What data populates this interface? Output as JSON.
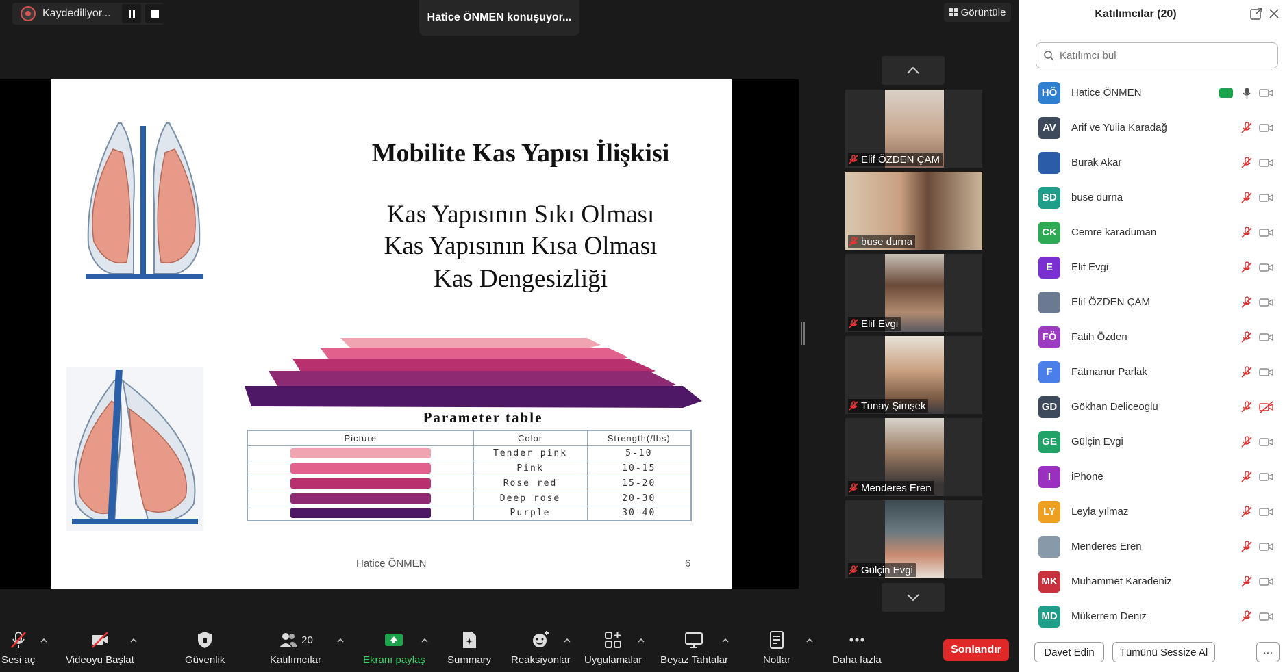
{
  "recording": {
    "label": "Kaydediliyor..."
  },
  "speaker": {
    "text": "Hatice ÖNMEN konuşuyor..."
  },
  "view": {
    "label": "Görüntüle"
  },
  "slide": {
    "title": "Mobilite Kas Yapısı İlişkisi",
    "lines": [
      "Kas Yapısının Sıkı Olması",
      "Kas Yapısının Kısa Olması",
      "Kas Dengesizliği"
    ],
    "table_title": "Parameter table",
    "table_headers": [
      "Picture",
      "Color",
      "Strength(/lbs)"
    ],
    "table_rows": [
      {
        "color_name": "Tender pink",
        "strength": "5-10",
        "swatch": "#f0a3b0"
      },
      {
        "color_name": "Pink",
        "strength": "10-15",
        "swatch": "#e2608c"
      },
      {
        "color_name": "Rose red",
        "strength": "15-20",
        "swatch": "#b9306f"
      },
      {
        "color_name": "Deep rose",
        "strength": "20-30",
        "swatch": "#8e2a72"
      },
      {
        "color_name": "Purple",
        "strength": "30-40",
        "swatch": "#4f1866"
      }
    ],
    "footer_name": "Hatice ÖNMEN",
    "page_number": "6"
  },
  "gallery": {
    "tiles": [
      {
        "name": "Elif ÖZDEN ÇAM"
      },
      {
        "name": "buse durna"
      },
      {
        "name": "Elif Evgi"
      },
      {
        "name": "Tunay Şimşek"
      },
      {
        "name": "Menderes Eren"
      },
      {
        "name": "Gülçin Evgi"
      }
    ]
  },
  "toolbar": {
    "unmute": "Sesi aç",
    "start_video": "Videoyu Başlat",
    "security": "Güvenlik",
    "participants": "Katılımcılar",
    "participants_count": "20",
    "share": "Ekranı paylaş",
    "summary": "Summary",
    "reactions": "Reaksiyonlar",
    "apps": "Uygulamalar",
    "whiteboards": "Beyaz Tahtalar",
    "notes": "Notlar",
    "more": "Daha fazla",
    "end": "Sonlandır"
  },
  "panel": {
    "title": "Katılımcılar (20)",
    "search_placeholder": "Katılımcı bul",
    "participants": [
      {
        "initials": "HÖ",
        "name": "Hatice ÖNMEN",
        "color": "#2f7fd1"
      },
      {
        "initials": "AV",
        "name": "Arif ve Yulia Karadağ",
        "color": "#3d4a5c"
      },
      {
        "initials": "",
        "name": "Burak Akar",
        "color": "#2a5ca8"
      },
      {
        "initials": "BD",
        "name": "buse durna",
        "color": "#1f9e8a"
      },
      {
        "initials": "CK",
        "name": "Cemre karaduman",
        "color": "#2eaa55"
      },
      {
        "initials": "E",
        "name": "Elif Evgi",
        "color": "#7a2fd1"
      },
      {
        "initials": "",
        "name": "Elif ÖZDEN ÇAM",
        "color": "#6b7a90"
      },
      {
        "initials": "FÖ",
        "name": "Fatih Özden",
        "color": "#9b3bc2"
      },
      {
        "initials": "F",
        "name": "Fatmanur Parlak",
        "color": "#4a7ee8"
      },
      {
        "initials": "GD",
        "name": "Gökhan Deliceoglu",
        "color": "#3d4a5c"
      },
      {
        "initials": "GE",
        "name": "Gülçin Evgi",
        "color": "#21a368"
      },
      {
        "initials": "I",
        "name": "iPhone",
        "color": "#9b2fbf"
      },
      {
        "initials": "LY",
        "name": "Leyla yılmaz",
        "color": "#f0a020"
      },
      {
        "initials": "",
        "name": "Menderes Eren",
        "color": "#8899aa"
      },
      {
        "initials": "MK",
        "name": "Muhammet Karadeniz",
        "color": "#c9323c"
      },
      {
        "initials": "MD",
        "name": "Mükerrem Deniz",
        "color": "#1f9e8a"
      }
    ],
    "invite": "Davet Edin",
    "mute_all": "Tümünü Sessize Al",
    "more": "···"
  }
}
